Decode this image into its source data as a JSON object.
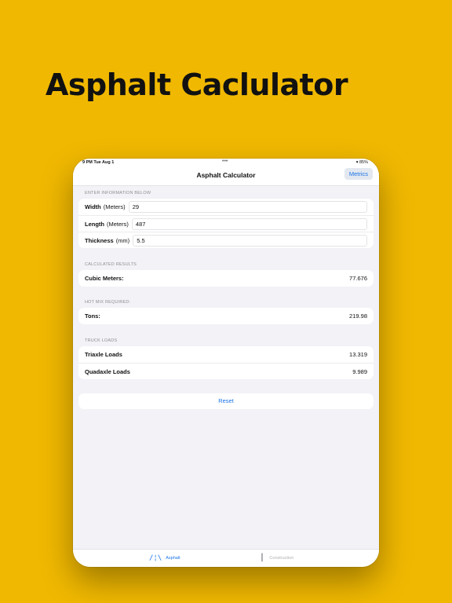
{
  "headline": "Asphalt Caclulator",
  "status_bar": {
    "time": "9 PM  Tue Aug 1",
    "dots": "•••",
    "battery": "85%"
  },
  "nav": {
    "title": "Asphalt Calculator",
    "metrics_button": "Metrics"
  },
  "inputs_section": {
    "header": "ENTER INFORMATION BELOW",
    "rows": [
      {
        "label": "Width",
        "unit": "(Meters)",
        "value": "29"
      },
      {
        "label": "Length",
        "unit": "(Meters)",
        "value": "487"
      },
      {
        "label": "Thickness",
        "unit": "(mm)",
        "value": "5.5"
      }
    ]
  },
  "calculated_section": {
    "header": "CALCULATED RESULTS",
    "label": "Cubic Meters:",
    "value": "77.676"
  },
  "hotmix_section": {
    "header": "HOT MIX REQUIRED:",
    "label": "Tons:",
    "value": "219.98"
  },
  "truck_section": {
    "header": "TRUCK LOADS",
    "rows": [
      {
        "label": "Triaxle Loads",
        "value": "13.319"
      },
      {
        "label": "Quadaxle Loads",
        "value": "9.989"
      }
    ]
  },
  "reset_button": "Reset",
  "tabs": [
    {
      "label": "Asphalt",
      "icon": "road-icon",
      "active": true
    },
    {
      "label": "Construction",
      "icon": "building-icon",
      "active": false
    }
  ],
  "colors": {
    "background": "#F0B800",
    "accent": "#1A73E8"
  }
}
